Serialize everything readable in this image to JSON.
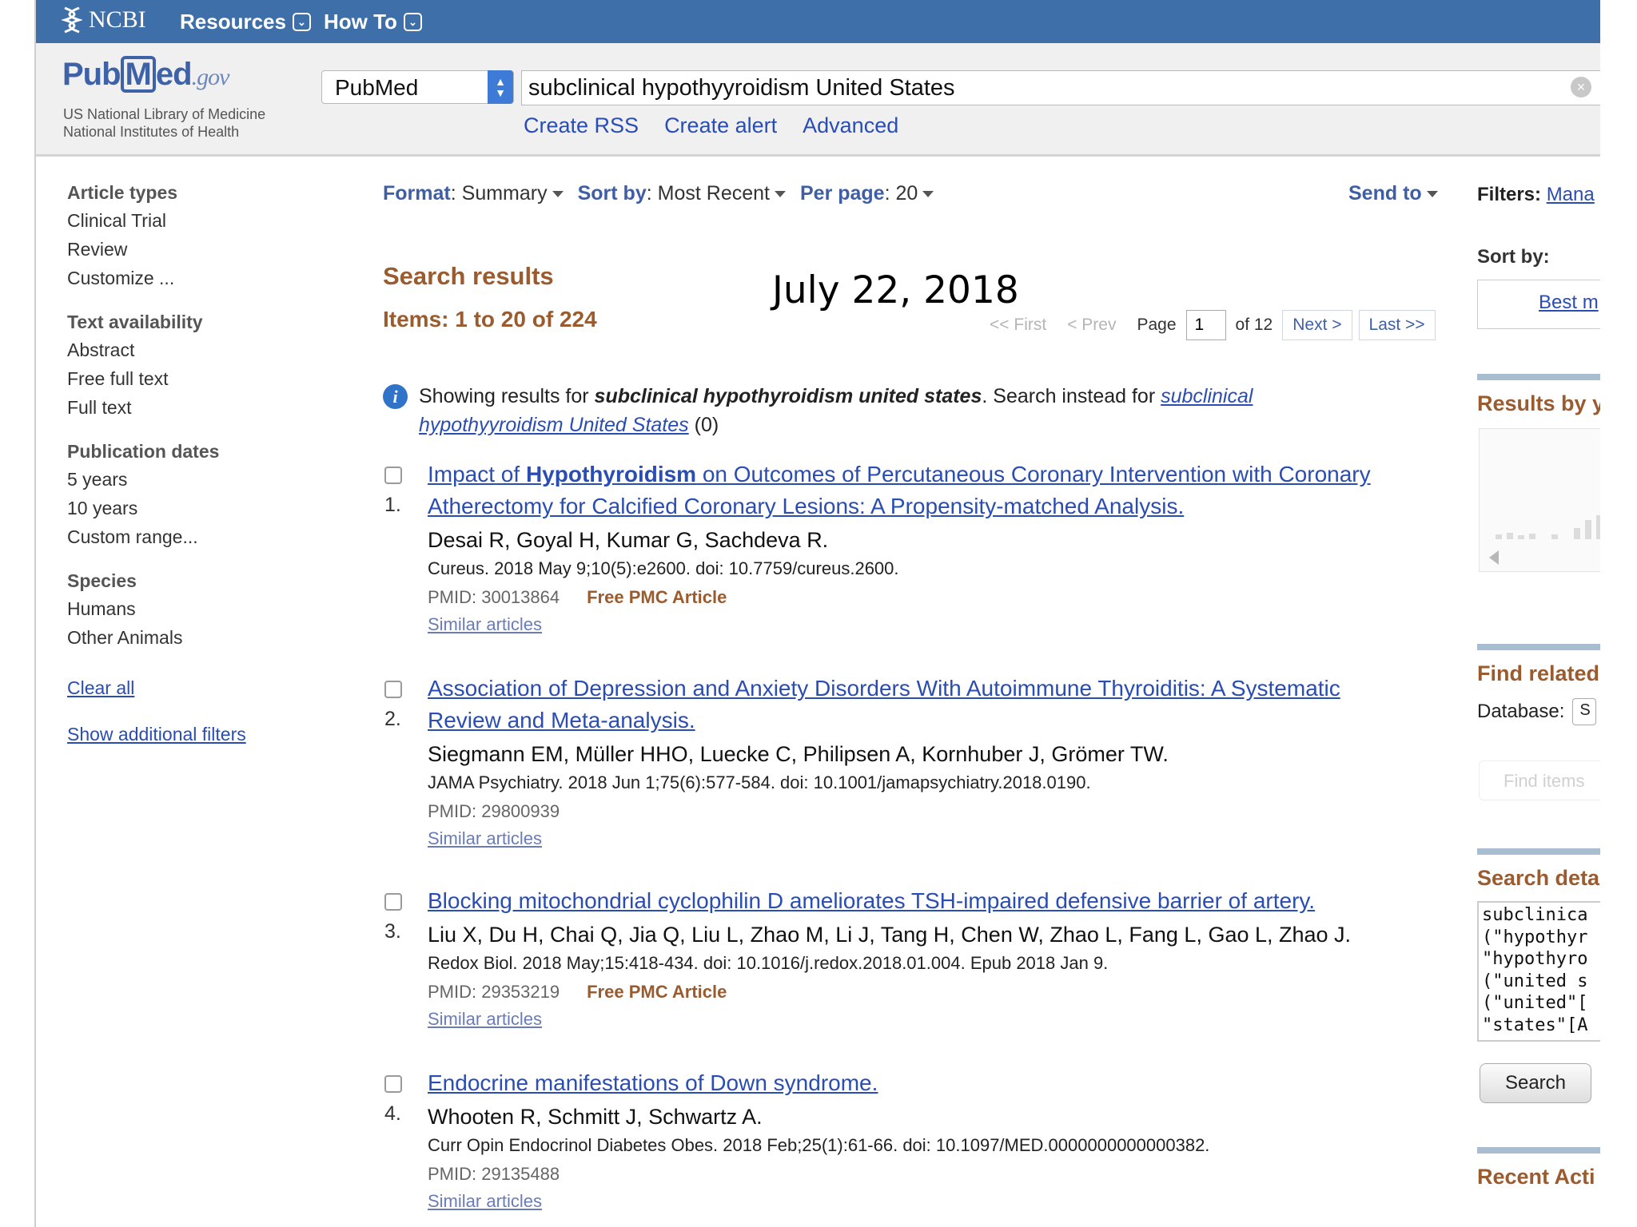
{
  "topbar": {
    "brand": "NCBI",
    "resources": "Resources",
    "how_to": "How To"
  },
  "header": {
    "logo_pub": "Pub",
    "logo_m": "M",
    "logo_ed": "ed",
    "logo_gov": ".gov",
    "org_line1": "US National Library of Medicine",
    "org_line2": "National Institutes of Health",
    "database": "PubMed",
    "query": "subclinical hypothyyroidism United States",
    "links": [
      "Create RSS",
      "Create alert",
      "Advanced"
    ]
  },
  "filters": {
    "article_types": {
      "title": "Article types",
      "items": [
        "Clinical Trial",
        "Review",
        "Customize ..."
      ]
    },
    "text_availability": {
      "title": "Text availability",
      "items": [
        "Abstract",
        "Free full text",
        "Full text"
      ]
    },
    "publication_dates": {
      "title": "Publication dates",
      "items": [
        "5 years",
        "10 years",
        "Custom range..."
      ]
    },
    "species": {
      "title": "Species",
      "items": [
        "Humans",
        "Other Animals"
      ]
    },
    "clear_all": "Clear all",
    "show_additional": "Show additional filters"
  },
  "format_bar": {
    "format_label": "Format",
    "format_value": "Summary",
    "sort_label": "Sort by",
    "sort_value": "Most Recent",
    "perpage_label": "Per page",
    "perpage_value": "20",
    "send_to": "Send to"
  },
  "results": {
    "heading": "Search results",
    "items_text": "Items: 1 to 20 of 224",
    "overlay_date": "July 22, 2018",
    "pager": {
      "first": "<< First",
      "prev": "< Prev",
      "page_label": "Page",
      "page_value": "1",
      "of_text": "of 12",
      "next": "Next >",
      "last": "Last >>"
    },
    "notice": {
      "prefix": "Showing results for ",
      "corrected": "subclinical hypothyroidism united states",
      "middle": ". Search instead for ",
      "original_link": "subclinical hypothyyroidism United States",
      "suffix": " (0)"
    },
    "list": [
      {
        "number": "1.",
        "title_pre": "Impact of ",
        "title_bold": "Hypothyroidism",
        "title_post": " on Outcomes of Percutaneous Coronary Intervention with Coronary Atherectomy for Calcified Coronary Lesions: A Propensity-matched Analysis.",
        "authors": "Desai R, Goyal H, Kumar G, Sachdeva R.",
        "citation": "Cureus. 2018 May 9;10(5):e2600. doi: 10.7759/cureus.2600.",
        "pmid": "PMID: 30013864",
        "free_pmc": "Free PMC Article",
        "similar": "Similar articles"
      },
      {
        "number": "2.",
        "title_pre": "Association of Depression and Anxiety Disorders With Autoimmune Thyroiditis: A Systematic Review and Meta-analysis.",
        "title_bold": "",
        "title_post": "",
        "authors": "Siegmann EM, Müller HHO, Luecke C, Philipsen A, Kornhuber J, Grömer TW.",
        "citation": "JAMA Psychiatry. 2018 Jun 1;75(6):577-584. doi: 10.1001/jamapsychiatry.2018.0190.",
        "pmid": "PMID: 29800939",
        "free_pmc": "",
        "similar": "Similar articles"
      },
      {
        "number": "3.",
        "title_pre": "Blocking mitochondrial cyclophilin D ameliorates TSH-impaired defensive barrier of artery.",
        "title_bold": "",
        "title_post": "",
        "authors": "Liu X, Du H, Chai Q, Jia Q, Liu L, Zhao M, Li J, Tang H, Chen W, Zhao L, Fang L, Gao L, Zhao J.",
        "citation": "Redox Biol. 2018 May;15:418-434. doi: 10.1016/j.redox.2018.01.004. Epub 2018 Jan 9.",
        "pmid": "PMID: 29353219",
        "free_pmc": "Free PMC Article",
        "similar": "Similar articles"
      },
      {
        "number": "4.",
        "title_pre": "Endocrine manifestations of Down syndrome.",
        "title_bold": "",
        "title_post": "",
        "authors": "Whooten R, Schmitt J, Schwartz A.",
        "citation": "Curr Opin Endocrinol Diabetes Obes. 2018 Feb;25(1):61-66. doi: 10.1097/MED.0000000000000382.",
        "pmid": "PMID: 29135488",
        "free_pmc": "",
        "similar": "Similar articles"
      }
    ]
  },
  "right_column": {
    "filters_label": "Filters:",
    "filters_link": "Mana",
    "sort_by_label": "Sort by:",
    "sort_by_value": "Best m",
    "results_by_year": "Results by y",
    "find_related": "Find related",
    "database_label": "Database:",
    "database_value": "S",
    "find_items": "Find items",
    "search_details": "Search deta",
    "search_details_text": "subclinica\n(\"hypothyr\n\"hypothyro\n(\"united s\n(\"united\"[\n\"states\"[A",
    "search_button": "Search",
    "recent_activity": "Recent Acti"
  },
  "colors": {
    "topbar": "#3f6fa8",
    "link": "#2a4db3",
    "heading_brown": "#9a5b2f"
  }
}
